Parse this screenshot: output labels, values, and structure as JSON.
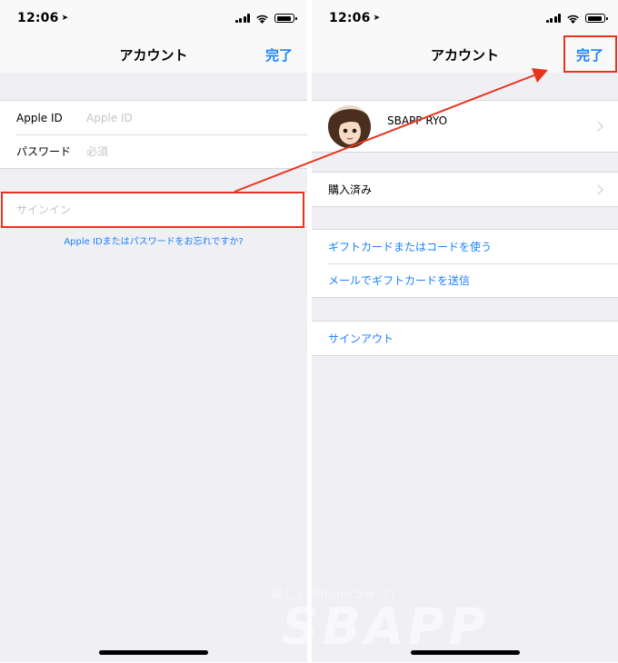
{
  "left_screen": {
    "status": {
      "time": "12:06",
      "location_glyph": "➤"
    },
    "nav": {
      "title": "アカウント",
      "done": "完了"
    },
    "form": {
      "apple_id_label": "Apple ID",
      "apple_id_placeholder": "Apple ID",
      "password_label": "パスワード",
      "password_placeholder": "必須"
    },
    "sign_in": "サインイン",
    "forgot": "Apple IDまたはパスワードをお忘れですか?"
  },
  "right_screen": {
    "status": {
      "time": "12:06",
      "location_glyph": "➤"
    },
    "nav": {
      "title": "アカウント",
      "done": "完了"
    },
    "profile": {
      "name": "SBAPP RYO"
    },
    "purchased": "購入済み",
    "gift_redeem": "ギフトカードまたはコードを使う",
    "gift_send": "メールでギフトカードを送信",
    "sign_out": "サインアウト"
  },
  "watermark": {
    "subtitle": "楽しいiPhoneライフ!",
    "logo": "SBAPP"
  },
  "colors": {
    "accent": "#1a82fb",
    "highlight": "#e8341c",
    "background": "#efeff4"
  }
}
